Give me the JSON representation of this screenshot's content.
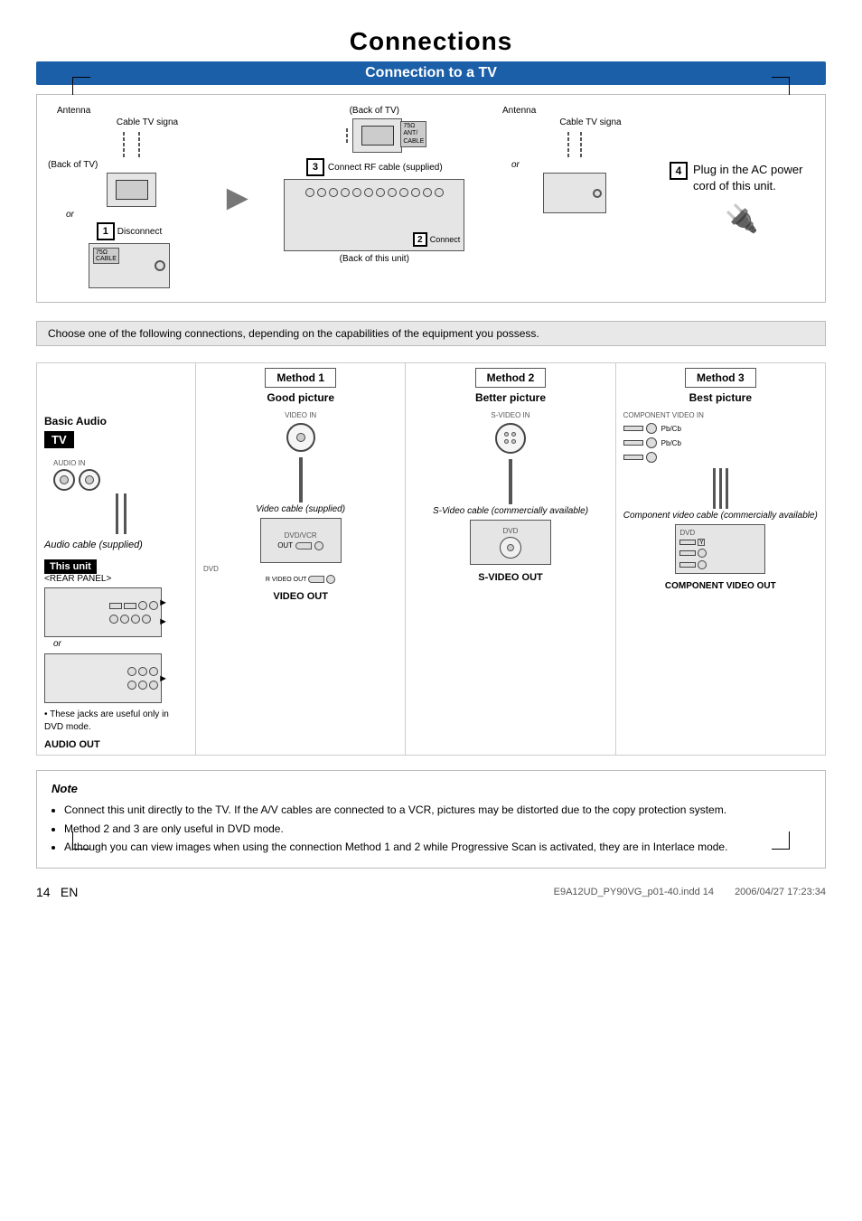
{
  "title": "Connections",
  "section1": {
    "header": "Connection to a TV"
  },
  "top_diagram": {
    "labels": {
      "antenna": "Antenna",
      "cable_tv": "Cable TV signa",
      "back_of_tv": "(Back of TV)",
      "or": "or",
      "disconnect": "Disconnect",
      "back_of_unit": "(Back of this unit)",
      "connect_rf": "Connect RF cable (supplied)",
      "connect2": "Connect",
      "step1": "1",
      "step2": "2",
      "step3": "3",
      "step4": "4",
      "plug_text": "Plug in the AC power cord of this unit."
    }
  },
  "choose_banner": "Choose one of the following connections, depending on the capabilities of the equipment you possess.",
  "methods": {
    "basic_audio": "Basic Audio",
    "tv": "TV",
    "this_unit": "This unit",
    "rear_panel": "<REAR PANEL>",
    "method1": {
      "label": "Method 1",
      "quality": "Good picture",
      "cable_label": "Audio cable (supplied)",
      "output_label": "AUDIO OUT"
    },
    "method2": {
      "label": "Method 2",
      "quality": "Better picture",
      "cable_label": "Video cable (supplied)",
      "output_label": "VIDEO OUT"
    },
    "method3": {
      "label": "Method 3",
      "quality": "Best picture",
      "cable_label": "Component video cable (commercially available)",
      "output_label": "COMPONENT VIDEO OUT"
    },
    "svideo_label": "S-Video cable (commercially available)",
    "svideo_output": "S-VIDEO OUT",
    "jacks_note": "These jacks are useful only in DVD mode."
  },
  "note": {
    "title": "Note",
    "items": [
      "Connect this unit directly to the TV. If the A/V cables are connected to a VCR, pictures may be distorted due to the copy protection system.",
      "Method 2 and 3 are only useful in DVD mode.",
      "Although you can view images when using the connection Method 1 and 2 while Progressive Scan is activated, they are in Interlace mode."
    ]
  },
  "footer": {
    "page": "14",
    "lang": "EN",
    "file": "E9A12UD_PY90VG_p01-40.indd  14",
    "date": "2006/04/27  17:23:34"
  }
}
